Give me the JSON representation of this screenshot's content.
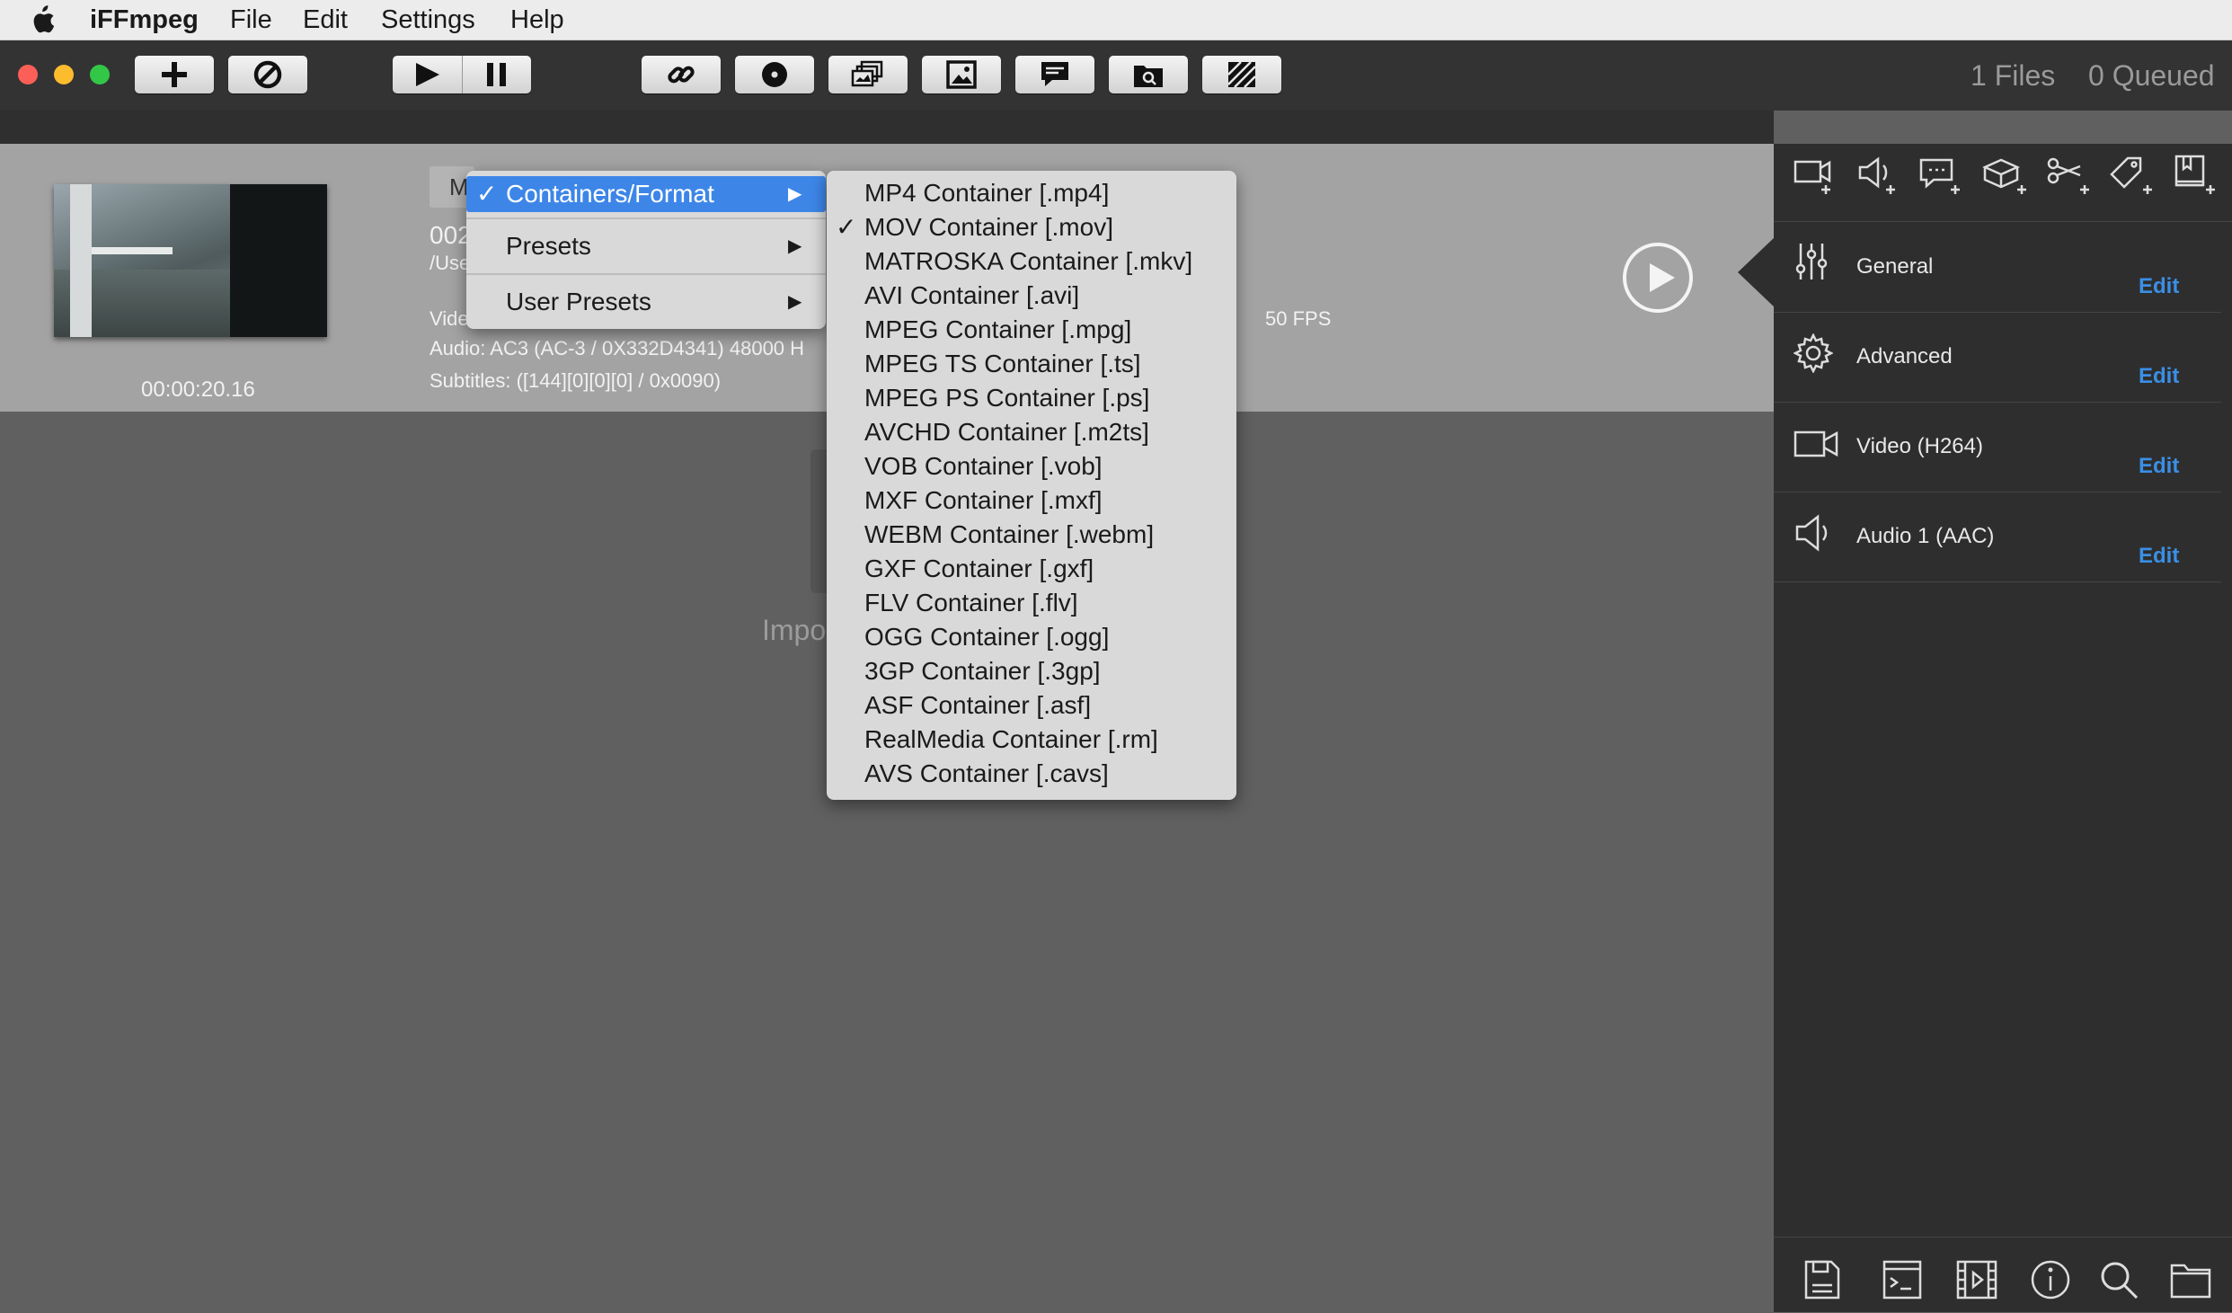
{
  "menubar": {
    "app_name": "iFFmpeg",
    "items": [
      "File",
      "Edit",
      "Settings",
      "Help"
    ]
  },
  "status": {
    "files": "1 Files",
    "queued": "0 Queued"
  },
  "file": {
    "name_partial": "002",
    "path_partial": "/Use",
    "duration": "00:00:20.16",
    "video_partial": "Vide",
    "fps": "50 FPS",
    "audio": "Audio: AC3 (AC-3 / 0X332D4341)  48000 H",
    "subtitles": "Subtitles: ([144][0][0][0] / 0x0090)",
    "tag_partial": "M",
    "import_partial": "Impo"
  },
  "context_menu": {
    "items": [
      {
        "label": "Containers/Format",
        "checked": true,
        "highlighted": true
      },
      {
        "label": "Presets",
        "checked": false
      },
      {
        "label": "User Presets",
        "checked": false
      }
    ]
  },
  "container_menu": {
    "items": [
      {
        "label": "MP4 Container [.mp4]",
        "checked": false
      },
      {
        "label": "MOV Container [.mov]",
        "checked": true
      },
      {
        "label": "MATROSKA Container [.mkv]",
        "checked": false
      },
      {
        "label": "AVI Container [.avi]",
        "checked": false
      },
      {
        "label": "MPEG Container [.mpg]",
        "checked": false
      },
      {
        "label": "MPEG TS Container [.ts]",
        "checked": false
      },
      {
        "label": "MPEG PS Container [.ps]",
        "checked": false
      },
      {
        "label": "AVCHD Container [.m2ts]",
        "checked": false
      },
      {
        "label": "VOB Container [.vob]",
        "checked": false
      },
      {
        "label": "MXF Container [.mxf]",
        "checked": false
      },
      {
        "label": "WEBM Container [.webm]",
        "checked": false
      },
      {
        "label": "GXF Container [.gxf]",
        "checked": false
      },
      {
        "label": "FLV Container [.flv]",
        "checked": false
      },
      {
        "label": "OGG Container [.ogg]",
        "checked": false
      },
      {
        "label": "3GP Container [.3gp]",
        "checked": false
      },
      {
        "label": "ASF Container [.asf]",
        "checked": false
      },
      {
        "label": "RealMedia Container [.rm]",
        "checked": false
      },
      {
        "label": "AVS Container [.cavs]",
        "checked": false
      }
    ]
  },
  "settings_panel": {
    "rows": [
      {
        "label": "General",
        "edit": "Edit",
        "icon": "sliders-icon"
      },
      {
        "label": "Advanced",
        "edit": "Edit",
        "icon": "gear-icon"
      },
      {
        "label": "Video (H264)",
        "edit": "Edit",
        "icon": "video-camera-icon"
      },
      {
        "label": "Audio 1 (AAC)",
        "edit": "Edit",
        "icon": "speaker-icon"
      }
    ]
  },
  "colors": {
    "accent_blue": "#3a8fe6",
    "menu_highlight": "#3d86e8",
    "close": "#fc5f57",
    "minimize": "#fdbc2e",
    "zoom": "#33c748"
  }
}
